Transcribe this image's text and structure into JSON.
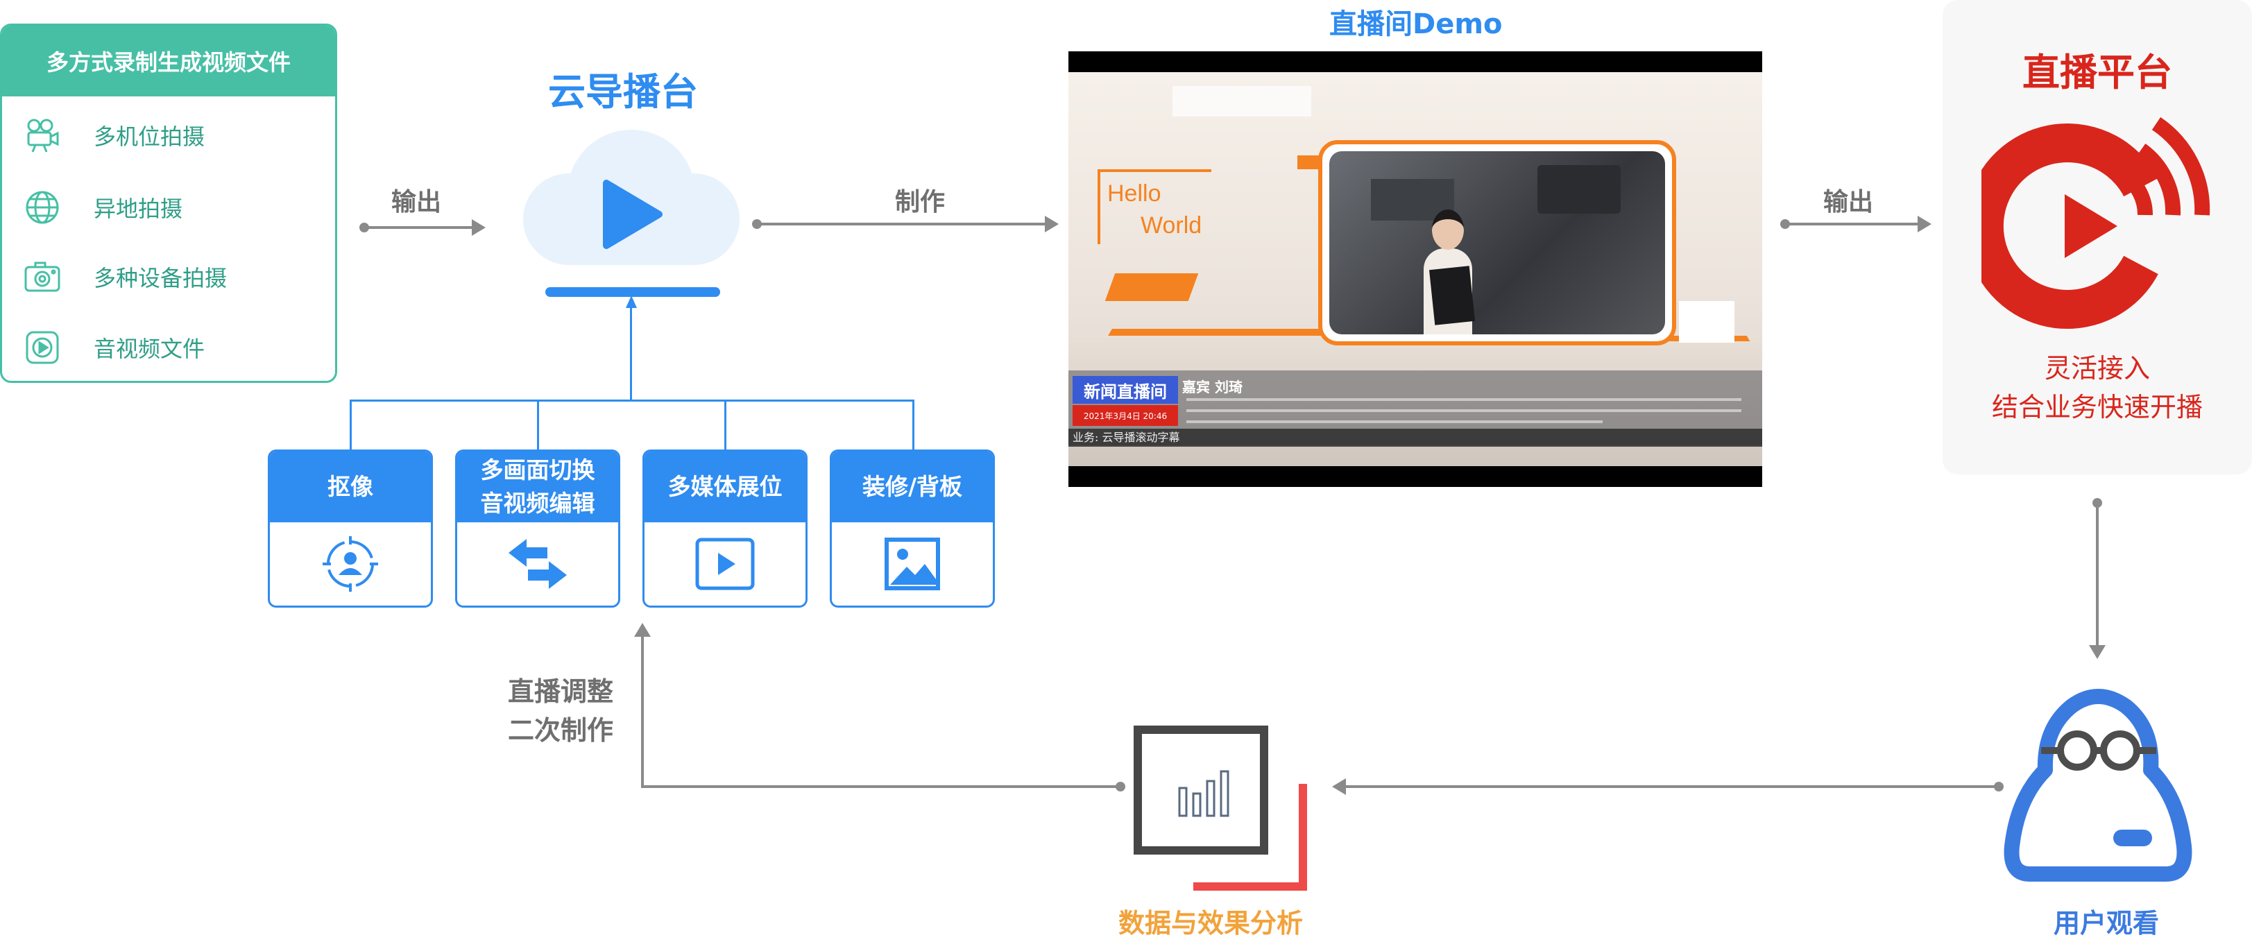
{
  "recording_panel": {
    "title": "多方式录制生成视频文件",
    "items": [
      {
        "label": "多机位拍摄",
        "icon": "camera-icon"
      },
      {
        "label": "异地拍摄",
        "icon": "globe-icon"
      },
      {
        "label": "多种设备拍摄",
        "icon": "device-camera-icon"
      },
      {
        "label": "音视频文件",
        "icon": "media-file-icon"
      }
    ]
  },
  "cloud": {
    "title": "云导播台",
    "icon": "play-cloud-icon"
  },
  "arrows": {
    "output_left": "输出",
    "make": "制作",
    "output_right": "输出"
  },
  "features": [
    {
      "label": "抠像",
      "icon": "person-target-icon"
    },
    {
      "label": "多画面切换\n音视频编辑",
      "icon": "swap-arrows-icon"
    },
    {
      "label": "多媒体展位",
      "icon": "play-screen-icon"
    },
    {
      "label": "装修/背板",
      "icon": "image-icon"
    }
  ],
  "demo": {
    "title": "直播间Demo",
    "hello_line1": "Hello",
    "hello_line2": "World",
    "news_badge": "新闻直播间",
    "date": "2021年3月4日 20:46",
    "guest": "嘉宾 刘琦",
    "ticker": "业务: 云导播滚动字幕"
  },
  "platform": {
    "title": "直播平台",
    "desc_line1": "灵活接入",
    "desc_line2": "结合业务快速开播",
    "brand_color": "#d9261c"
  },
  "adjust": {
    "line1": "直播调整",
    "line2": "二次制作"
  },
  "analysis": {
    "label": "数据与效果分析",
    "icon": "bar-chart-icon"
  },
  "user": {
    "label": "用户观看",
    "icon": "user-glasses-icon"
  }
}
